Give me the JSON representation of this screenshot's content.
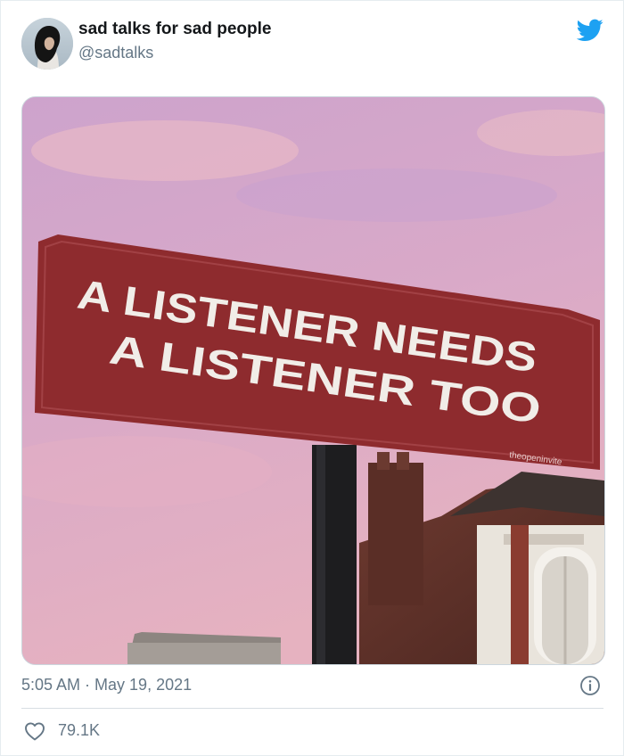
{
  "author": {
    "display_name": "sad talks for sad people",
    "handle": "@sadtalks",
    "avatar_icon": "profile-photo-person"
  },
  "brand": {
    "icon": "twitter-bird-icon",
    "color": "#1da1f2"
  },
  "media": {
    "description_kind": "photo",
    "sign_text": {
      "line1": "A LISTENER NEEDS",
      "line2": "A LISTENER TOO",
      "watermark": "theopeninvite"
    },
    "sign_color": "#8e2b2e",
    "sky_color": "#d9a8c8"
  },
  "meta": {
    "timestamp": "5:05 AM · May 19, 2021"
  },
  "actions": {
    "likes": "79.1K"
  },
  "colors": {
    "secondary_text": "#657786",
    "primary_text": "#14171a"
  }
}
